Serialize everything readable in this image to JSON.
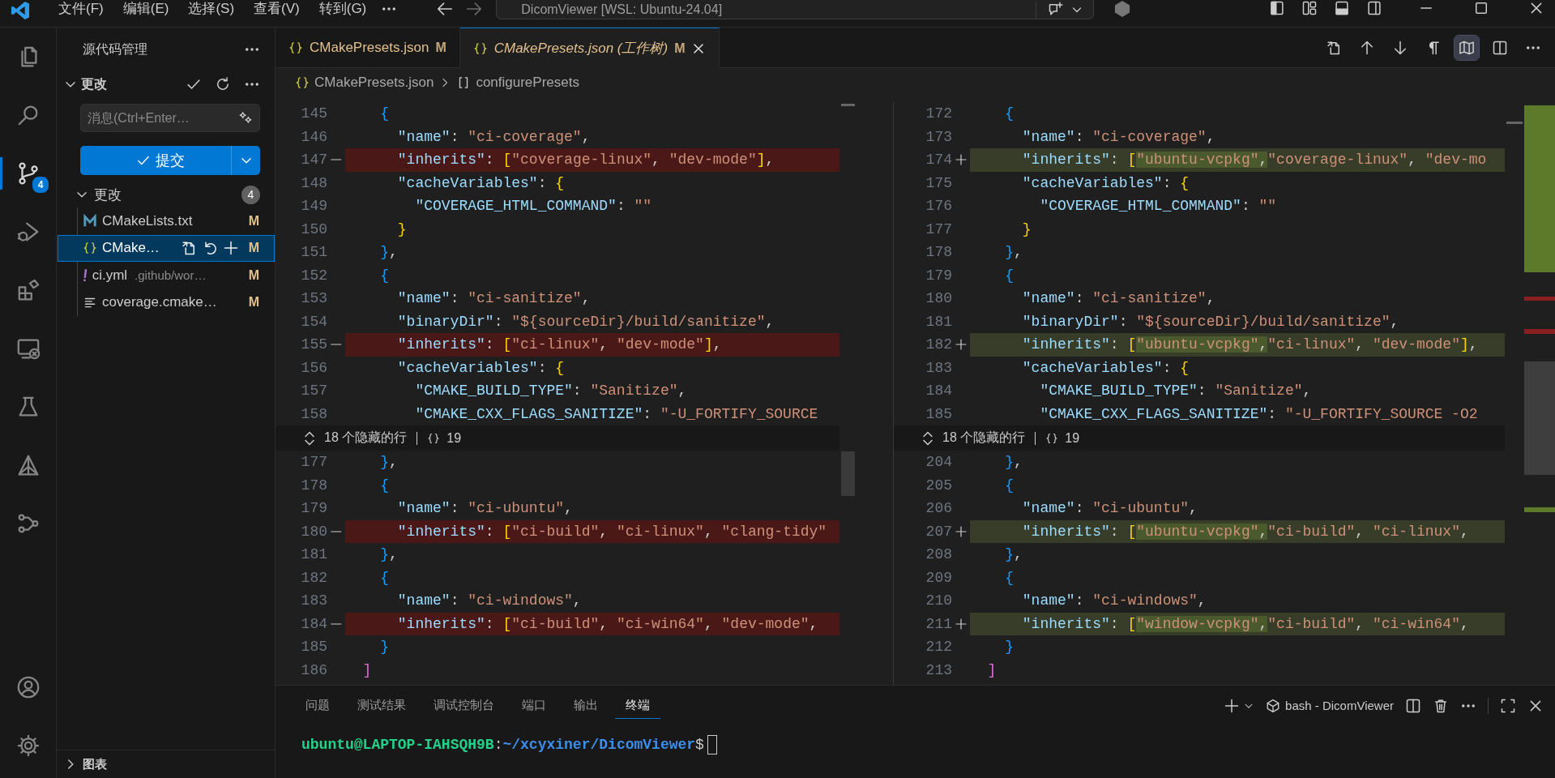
{
  "title_bar": {
    "menus": [
      "文件(F)",
      "编辑(E)",
      "选择(S)",
      "查看(V)",
      "转到(G)"
    ],
    "command_center": "DicomViewer [WSL: Ubuntu-24.04]"
  },
  "activity_bar": {
    "items": [
      {
        "kind": "files",
        "selected": false
      },
      {
        "kind": "search",
        "selected": false
      },
      {
        "kind": "scm",
        "selected": true,
        "badge": "4"
      },
      {
        "kind": "debug",
        "selected": false
      },
      {
        "kind": "extensions",
        "selected": false
      },
      {
        "kind": "remote",
        "selected": false
      },
      {
        "kind": "flask",
        "selected": false
      },
      {
        "kind": "triangle",
        "selected": false
      },
      {
        "kind": "graph",
        "selected": false
      }
    ],
    "bottom": [
      {
        "kind": "account"
      },
      {
        "kind": "gear"
      }
    ]
  },
  "sidebar": {
    "title": "源代码管理",
    "section": {
      "label": "更改",
      "expanded": true
    },
    "message_placeholder": "消息(Ctrl+Enter…",
    "commit_label": "提交",
    "group": {
      "label": "更改",
      "count": "4",
      "expanded": true
    },
    "files": [
      {
        "kind": "m",
        "name": "CMakeLists.txt",
        "status": "M",
        "selected": false
      },
      {
        "kind": "braces",
        "name": "CMake…",
        "status": "M",
        "selected": true
      },
      {
        "kind": "exclaim",
        "name": "ci.yml",
        "description": ".github/wor…",
        "status": "M",
        "selected": false
      },
      {
        "kind": "lines",
        "name": "coverage.cmake…",
        "status": "M",
        "selected": false
      }
    ],
    "footer": {
      "label": "图表",
      "expanded": false
    }
  },
  "editor": {
    "tabs": [
      {
        "label": "CMakePresets.json",
        "status": "M",
        "selected": false,
        "preview": false
      },
      {
        "label": "CMakePresets.json (工作树)",
        "status": "M",
        "selected": true,
        "preview": true
      }
    ],
    "toolbar": [
      {
        "kind": "openfile",
        "on": false
      },
      {
        "kind": "up",
        "on": false
      },
      {
        "kind": "down",
        "on": false
      },
      {
        "kind": "pilcrow",
        "on": false
      },
      {
        "kind": "map",
        "on": true
      },
      {
        "kind": "split",
        "on": false
      },
      {
        "kind": "more",
        "on": false
      }
    ],
    "breadcrumb": [
      "CMakePresets.json",
      "configurePresets"
    ],
    "diff": {
      "panes": [
        {
          "fold": {
            "label": "18 个隐藏的行",
            "count": "19"
          },
          "sections": [
            {
              "lines": [
                {
                  "num": "145",
                  "kind": "context",
                  "text": "    {"
                },
                {
                  "num": "146",
                  "kind": "context",
                  "text": "      \"name\": \"ci-coverage\","
                },
                {
                  "num": "147",
                  "kind": "removed",
                  "text": "      \"inherits\": [\"coverage-linux\", \"dev-mode\"],"
                },
                {
                  "num": "148",
                  "kind": "context",
                  "text": "      \"cacheVariables\": {"
                },
                {
                  "num": "149",
                  "kind": "context",
                  "text": "        \"COVERAGE_HTML_COMMAND\": \"\""
                },
                {
                  "num": "150",
                  "kind": "context",
                  "text": "      }"
                },
                {
                  "num": "151",
                  "kind": "context",
                  "text": "    },"
                },
                {
                  "num": "152",
                  "kind": "context",
                  "text": "    {"
                },
                {
                  "num": "153",
                  "kind": "context",
                  "text": "      \"name\": \"ci-sanitize\","
                },
                {
                  "num": "154",
                  "kind": "context",
                  "text": "      \"binaryDir\": \"${sourceDir}/build/sanitize\","
                },
                {
                  "num": "155",
                  "kind": "removed",
                  "text": "      \"inherits\": [\"ci-linux\", \"dev-mode\"],"
                },
                {
                  "num": "156",
                  "kind": "context",
                  "text": "      \"cacheVariables\": {"
                },
                {
                  "num": "157",
                  "kind": "context",
                  "text": "        \"CMAKE_BUILD_TYPE\": \"Sanitize\","
                },
                {
                  "num": "158",
                  "kind": "context",
                  "text": "        \"CMAKE_CXX_FLAGS_SANITIZE\": \"-U_FORTIFY_SOURCE"
                }
              ]
            },
            {
              "lines": [
                {
                  "num": "177",
                  "kind": "context",
                  "text": "    },"
                },
                {
                  "num": "178",
                  "kind": "context",
                  "text": "    {"
                },
                {
                  "num": "179",
                  "kind": "context",
                  "text": "      \"name\": \"ci-ubuntu\","
                },
                {
                  "num": "180",
                  "kind": "removed",
                  "text": "      \"inherits\": [\"ci-build\", \"ci-linux\", \"clang-tidy\""
                },
                {
                  "num": "181",
                  "kind": "context",
                  "text": "    },"
                },
                {
                  "num": "182",
                  "kind": "context",
                  "text": "    {"
                },
                {
                  "num": "183",
                  "kind": "context",
                  "text": "      \"name\": \"ci-windows\","
                },
                {
                  "num": "184",
                  "kind": "removed",
                  "text": "      \"inherits\": [\"ci-build\", \"ci-win64\", \"dev-mode\","
                },
                {
                  "num": "185",
                  "kind": "context",
                  "text": "    }"
                },
                {
                  "num": "186",
                  "kind": "context",
                  "text": "  ]"
                }
              ]
            }
          ]
        },
        {
          "fold": {
            "label": "18 个隐藏的行",
            "count": "19"
          },
          "sections": [
            {
              "lines": [
                {
                  "num": "172",
                  "kind": "context",
                  "text": "    {"
                },
                {
                  "num": "173",
                  "kind": "context",
                  "text": "      \"name\": \"ci-coverage\","
                },
                {
                  "num": "174",
                  "kind": "added",
                  "text": "      \"inherits\": [",
                  "inserted": "\"ubuntu-vcpkg\",",
                  "after": "\"coverage-linux\", \"dev-mo"
                },
                {
                  "num": "175",
                  "kind": "context",
                  "text": "      \"cacheVariables\": {"
                },
                {
                  "num": "176",
                  "kind": "context",
                  "text": "        \"COVERAGE_HTML_COMMAND\": \"\""
                },
                {
                  "num": "177",
                  "kind": "context",
                  "text": "      }"
                },
                {
                  "num": "178",
                  "kind": "context",
                  "text": "    },"
                },
                {
                  "num": "179",
                  "kind": "context",
                  "text": "    {"
                },
                {
                  "num": "180",
                  "kind": "context",
                  "text": "      \"name\": \"ci-sanitize\","
                },
                {
                  "num": "181",
                  "kind": "context",
                  "text": "      \"binaryDir\": \"${sourceDir}/build/sanitize\","
                },
                {
                  "num": "182",
                  "kind": "added",
                  "text": "      \"inherits\": [",
                  "inserted": "\"ubuntu-vcpkg\",",
                  "after": "\"ci-linux\", \"dev-mode\"],"
                },
                {
                  "num": "183",
                  "kind": "context",
                  "text": "      \"cacheVariables\": {"
                },
                {
                  "num": "184",
                  "kind": "context",
                  "text": "        \"CMAKE_BUILD_TYPE\": \"Sanitize\","
                },
                {
                  "num": "185",
                  "kind": "context",
                  "text": "        \"CMAKE_CXX_FLAGS_SANITIZE\": \"-U_FORTIFY_SOURCE -O2"
                }
              ]
            },
            {
              "lines": [
                {
                  "num": "204",
                  "kind": "context",
                  "text": "    },"
                },
                {
                  "num": "205",
                  "kind": "context",
                  "text": "    {"
                },
                {
                  "num": "206",
                  "kind": "context",
                  "text": "      \"name\": \"ci-ubuntu\","
                },
                {
                  "num": "207",
                  "kind": "added",
                  "text": "      \"inherits\": [",
                  "inserted": "\"ubuntu-vcpkg\",",
                  "after": "\"ci-build\", \"ci-linux\","
                },
                {
                  "num": "208",
                  "kind": "context",
                  "text": "    },"
                },
                {
                  "num": "209",
                  "kind": "context",
                  "text": "    {"
                },
                {
                  "num": "210",
                  "kind": "context",
                  "text": "      \"name\": \"ci-windows\","
                },
                {
                  "num": "211",
                  "kind": "added",
                  "text": "      \"inherits\": [",
                  "inserted": "\"window-vcpkg\",",
                  "after": "\"ci-build\", \"ci-win64\","
                },
                {
                  "num": "212",
                  "kind": "context",
                  "text": "    }"
                },
                {
                  "num": "213",
                  "kind": "context",
                  "text": "  ]"
                }
              ]
            }
          ]
        }
      ]
    }
  },
  "panel": {
    "tabs": [
      {
        "label": "问题",
        "selected": false
      },
      {
        "label": "测试结果",
        "selected": false
      },
      {
        "label": "调试控制台",
        "selected": false
      },
      {
        "label": "端口",
        "selected": false
      },
      {
        "label": "输出",
        "selected": false
      },
      {
        "label": "终端",
        "selected": true
      }
    ],
    "terminal_name": "bash - DicomViewer",
    "prompt": {
      "user_host": "ubuntu@LAPTOP-IAHSQH9B",
      "separator": ":",
      "path": "~/xcyxiner/DicomViewer",
      "sign": "$"
    }
  }
}
